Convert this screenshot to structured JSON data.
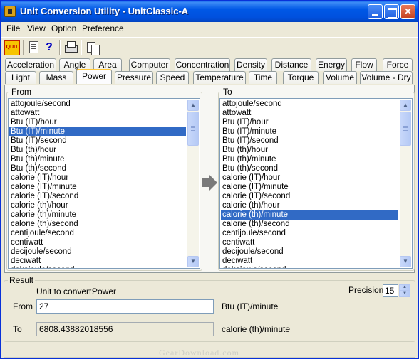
{
  "window": {
    "title": "Unit Conversion Utility - UnitClassic-A"
  },
  "menu": [
    "File",
    "View",
    "Option",
    "Preference"
  ],
  "toolbar": {
    "quit_label": "QUIT",
    "help_glyph": "?"
  },
  "tabs_row1": [
    "Acceleration",
    "Angle",
    "Area",
    "Computer",
    "Concentration",
    "Density",
    "Distance",
    "Energy",
    "Flow",
    "Force"
  ],
  "tabs_row2": [
    "Light",
    "Mass",
    "Power",
    "Pressure",
    "Speed",
    "Temperature",
    "Time",
    "Torque",
    "Volume",
    "Volume - Dry"
  ],
  "active_tab": "Power",
  "from": {
    "label": "From",
    "items": [
      "attojoule/second",
      "attowatt",
      "Btu (IT)/hour",
      "Btu (IT)/minute",
      "Btu (IT)/second",
      "Btu (th)/hour",
      "Btu (th)/minute",
      "Btu (th)/second",
      "calorie (IT)/hour",
      "calorie (IT)/minute",
      "calorie (IT)/second",
      "calorie (th)/hour",
      "calorie (th)/minute",
      "calorie (th)/second",
      "centijoule/second",
      "centiwatt",
      "decijoule/second",
      "deciwatt",
      "dekajoule/second"
    ],
    "selected": "Btu (IT)/minute"
  },
  "to": {
    "label": "To",
    "items": [
      "attojoule/second",
      "attowatt",
      "Btu (IT)/hour",
      "Btu (IT)/minute",
      "Btu (IT)/second",
      "Btu (th)/hour",
      "Btu (th)/minute",
      "Btu (th)/second",
      "calorie (IT)/hour",
      "calorie (IT)/minute",
      "calorie (IT)/second",
      "calorie (th)/hour",
      "calorie (th)/minute",
      "calorie (th)/second",
      "centijoule/second",
      "centiwatt",
      "decijoule/second",
      "deciwatt",
      "dekajoule/second"
    ],
    "selected": "calorie (th)/minute"
  },
  "result": {
    "label": "Result",
    "unit_caption": "Unit to convert:",
    "unit_value": "Power",
    "precision_label": "Precision",
    "precision_value": "15",
    "from_label": "From",
    "from_value": "27",
    "from_unit": "Btu (IT)/minute",
    "to_label": "To",
    "to_value": "6808.43882018556",
    "to_unit": "calorie (th)/minute"
  },
  "watermark": "GearDownload.com"
}
